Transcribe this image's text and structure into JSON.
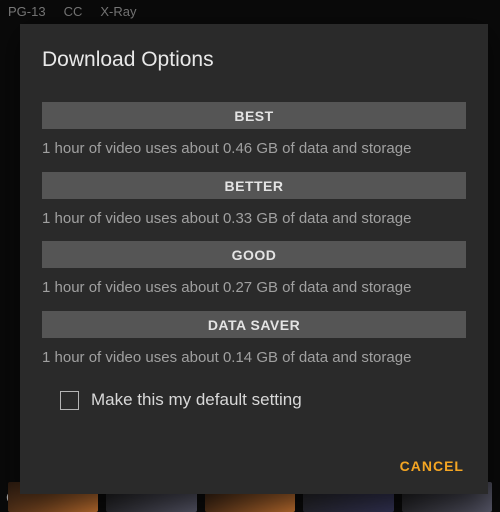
{
  "background": {
    "metadata": [
      "PG-13",
      "CC",
      "X-Ray"
    ],
    "partialLetter": "C"
  },
  "modal": {
    "title": "Download Options",
    "options": [
      {
        "label": "BEST",
        "description": "1 hour of video uses about 0.46 GB of data and storage"
      },
      {
        "label": "BETTER",
        "description": "1 hour of video uses about 0.33 GB of data and storage"
      },
      {
        "label": "GOOD",
        "description": "1 hour of video uses about 0.27 GB of data and storage"
      },
      {
        "label": "DATA SAVER",
        "description": "1 hour of video uses about 0.14 GB of data and storage"
      }
    ],
    "defaultCheckbox": {
      "checked": false,
      "label": "Make this my default setting"
    },
    "cancelLabel": "CANCEL"
  }
}
